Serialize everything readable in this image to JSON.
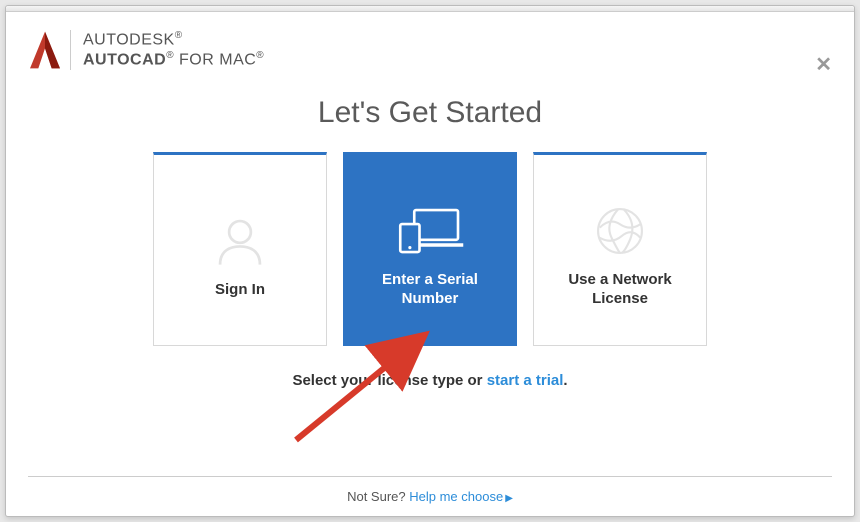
{
  "brand": {
    "line1": "AUTODESK",
    "product_bold": "AUTOCAD",
    "product_rest": " FOR MAC"
  },
  "title": "Let's Get Started",
  "cards": {
    "signin": {
      "label": "Sign In"
    },
    "serial": {
      "label": "Enter a Serial Number"
    },
    "network": {
      "label": "Use a Network License"
    }
  },
  "prompt": {
    "prefix": "Select your license type or ",
    "link": "start a trial",
    "suffix": "."
  },
  "footer": {
    "prefix": "Not Sure? ",
    "link": "Help me choose"
  }
}
